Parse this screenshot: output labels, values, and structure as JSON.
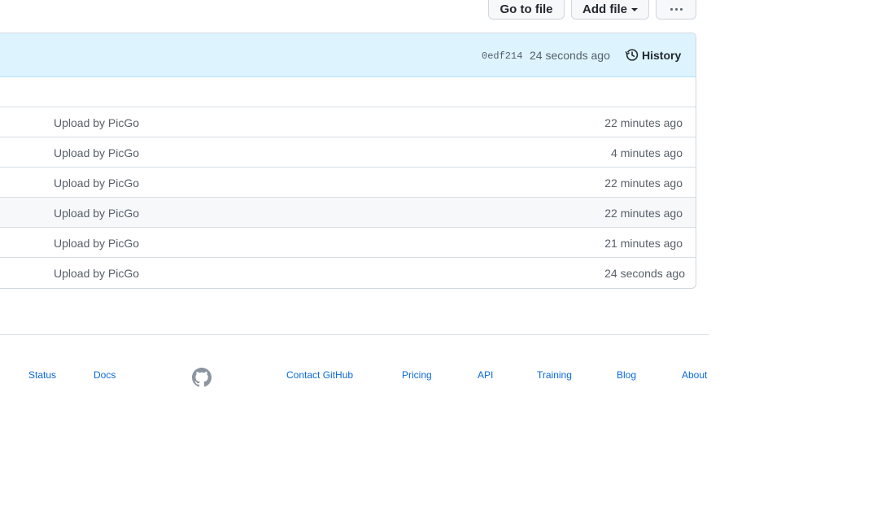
{
  "toolbar": {
    "go_to_file": "Go to file",
    "add_file": "Add file",
    "more_icon": "kebab-horizontal-icon"
  },
  "commit_header": {
    "sha": "0edf214",
    "time": "24 seconds ago",
    "history_label": "History",
    "history_icon": "history-icon",
    "bg_color": "#ddf4ff"
  },
  "files": [
    {
      "message": "Upload by PicGo",
      "age": "22 minutes ago"
    },
    {
      "message": "Upload by PicGo",
      "age": "4 minutes ago"
    },
    {
      "message": "Upload by PicGo",
      "age": "22 minutes ago"
    },
    {
      "message": "Upload by PicGo",
      "age": "22 minutes ago"
    },
    {
      "message": "Upload by PicGo",
      "age": "21 minutes ago"
    },
    {
      "message": "Upload by PicGo",
      "age": "24 seconds ago"
    }
  ],
  "footer": {
    "links": [
      "Status",
      "Docs",
      "Contact GitHub",
      "Pricing",
      "API",
      "Training",
      "Blog",
      "About"
    ],
    "logo_icon": "github-mark-icon",
    "link_color": "#0969da"
  }
}
